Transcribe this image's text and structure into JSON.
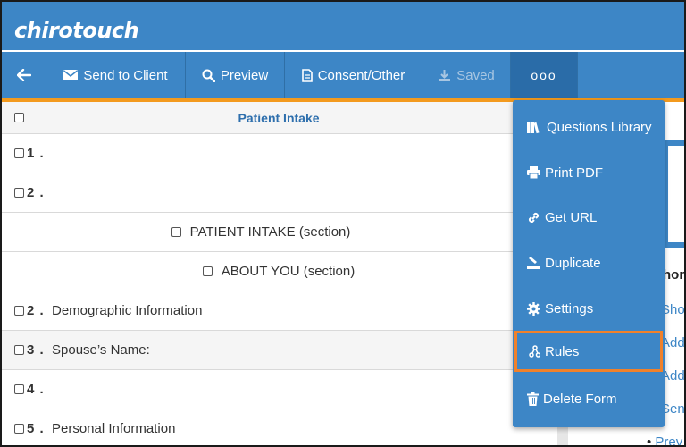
{
  "app": {
    "logo": "chirotouch"
  },
  "toolbar": {
    "send_label": "Send to Client",
    "preview_label": "Preview",
    "consent_label": "Consent/Other",
    "saved_label": "Saved",
    "more_label": "ooo"
  },
  "table": {
    "title": "Patient Intake",
    "rows": [
      {
        "num": "1 .",
        "text": ""
      },
      {
        "num": "2 .",
        "text": ""
      },
      {
        "num": "",
        "text": "PATIENT INTAKE (section)"
      },
      {
        "num": "",
        "text": "ABOUT YOU (section)"
      },
      {
        "num": "2 .",
        "text": "Demographic Information"
      },
      {
        "num": "3 .",
        "text": "Spouse’s Name:"
      },
      {
        "num": "4 .",
        "text": ""
      },
      {
        "num": "5 .",
        "text": "Personal Information"
      }
    ]
  },
  "menu": {
    "items": [
      {
        "label": "Questions Library",
        "icon": "books-icon"
      },
      {
        "label": "Print PDF",
        "icon": "printer-icon"
      },
      {
        "label": "Get URL",
        "icon": "link-icon"
      },
      {
        "label": "Duplicate",
        "icon": "duplicate-icon"
      },
      {
        "label": "Settings",
        "icon": "gear-icon"
      },
      {
        "label": "Rules",
        "icon": "rules-icon"
      },
      {
        "label": "Delete Form",
        "icon": "trash-icon"
      }
    ]
  },
  "right_panel": {
    "heading_fragment": "hon",
    "links": [
      "Show",
      "Add",
      "Add",
      "Send",
      "Prev"
    ]
  },
  "colors": {
    "header": "#3d86c6",
    "accent": "#f39a1e",
    "selected_outline": "#f0812a",
    "title": "#2e6fad"
  }
}
